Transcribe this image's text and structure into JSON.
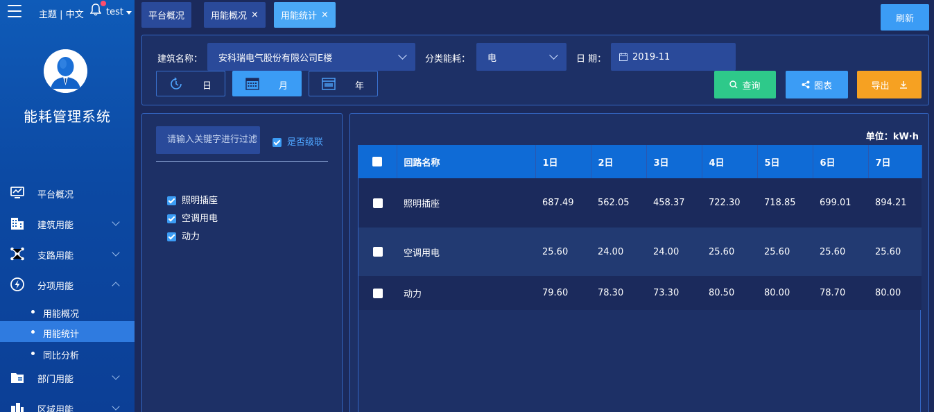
{
  "header": {
    "theme_link": "主题",
    "separator": "|",
    "language_link": "中文",
    "user_name": "test"
  },
  "sidebar": {
    "title": "能耗管理系统",
    "items": [
      {
        "label": "平台概况",
        "icon": "monitor-icon"
      },
      {
        "label": "建筑用能",
        "icon": "building-icon"
      },
      {
        "label": "支路用能",
        "icon": "network-icon"
      },
      {
        "label": "分项用能",
        "icon": "lightning-icon"
      },
      {
        "label": "部门用能",
        "icon": "folder-icon"
      },
      {
        "label": "区域用能",
        "icon": "region-icon"
      }
    ],
    "sub_items": [
      {
        "label": "用能概况",
        "active": false
      },
      {
        "label": "用能统计",
        "active": true
      },
      {
        "label": "同比分析",
        "active": false
      }
    ]
  },
  "tabs": [
    {
      "label": "平台概况",
      "closable": false
    },
    {
      "label": "用能概况",
      "closable": true
    },
    {
      "label": "用能统计",
      "closable": true,
      "active": true
    }
  ],
  "tab_close_glyph": "×",
  "refresh_label": "刷新",
  "filters": {
    "building_label": "建筑名称：",
    "building_value": "安科瑞电气股份有限公司E楼",
    "category_label": "分类能耗：",
    "category_value": "电",
    "date_label": "日 期：",
    "date_value": "2019-11",
    "periods": [
      {
        "label": "日",
        "active": false
      },
      {
        "label": "月",
        "active": true
      },
      {
        "label": "年",
        "active": false
      }
    ],
    "query_label": "查询",
    "chart_label": "图表",
    "export_label": "导出"
  },
  "tree": {
    "search_placeholder": "请输入关键字进行过滤",
    "cascade_label": "是否级联",
    "items": [
      "照明插座",
      "空调用电",
      "动力"
    ]
  },
  "table": {
    "unit_label": "单位：",
    "unit_value": "kW·h",
    "columns": [
      "回路名称",
      "1日",
      "2日",
      "3日",
      "4日",
      "5日",
      "6日",
      "7日"
    ],
    "rows": [
      {
        "name": "照明插座",
        "values": [
          "687.49",
          "562.05",
          "458.37",
          "722.30",
          "718.85",
          "699.01",
          "894.21"
        ]
      },
      {
        "name": "空调用电",
        "values": [
          "25.60",
          "24.00",
          "24.00",
          "25.60",
          "25.60",
          "25.60",
          "25.60"
        ]
      },
      {
        "name": "动力",
        "values": [
          "79.60",
          "78.30",
          "73.30",
          "80.50",
          "80.00",
          "78.70",
          "80.00"
        ]
      }
    ]
  },
  "colors": {
    "query": "#2ec98a",
    "chart": "#3b9cf5",
    "export": "#f6a122",
    "table_header": "#0f6bd6"
  }
}
